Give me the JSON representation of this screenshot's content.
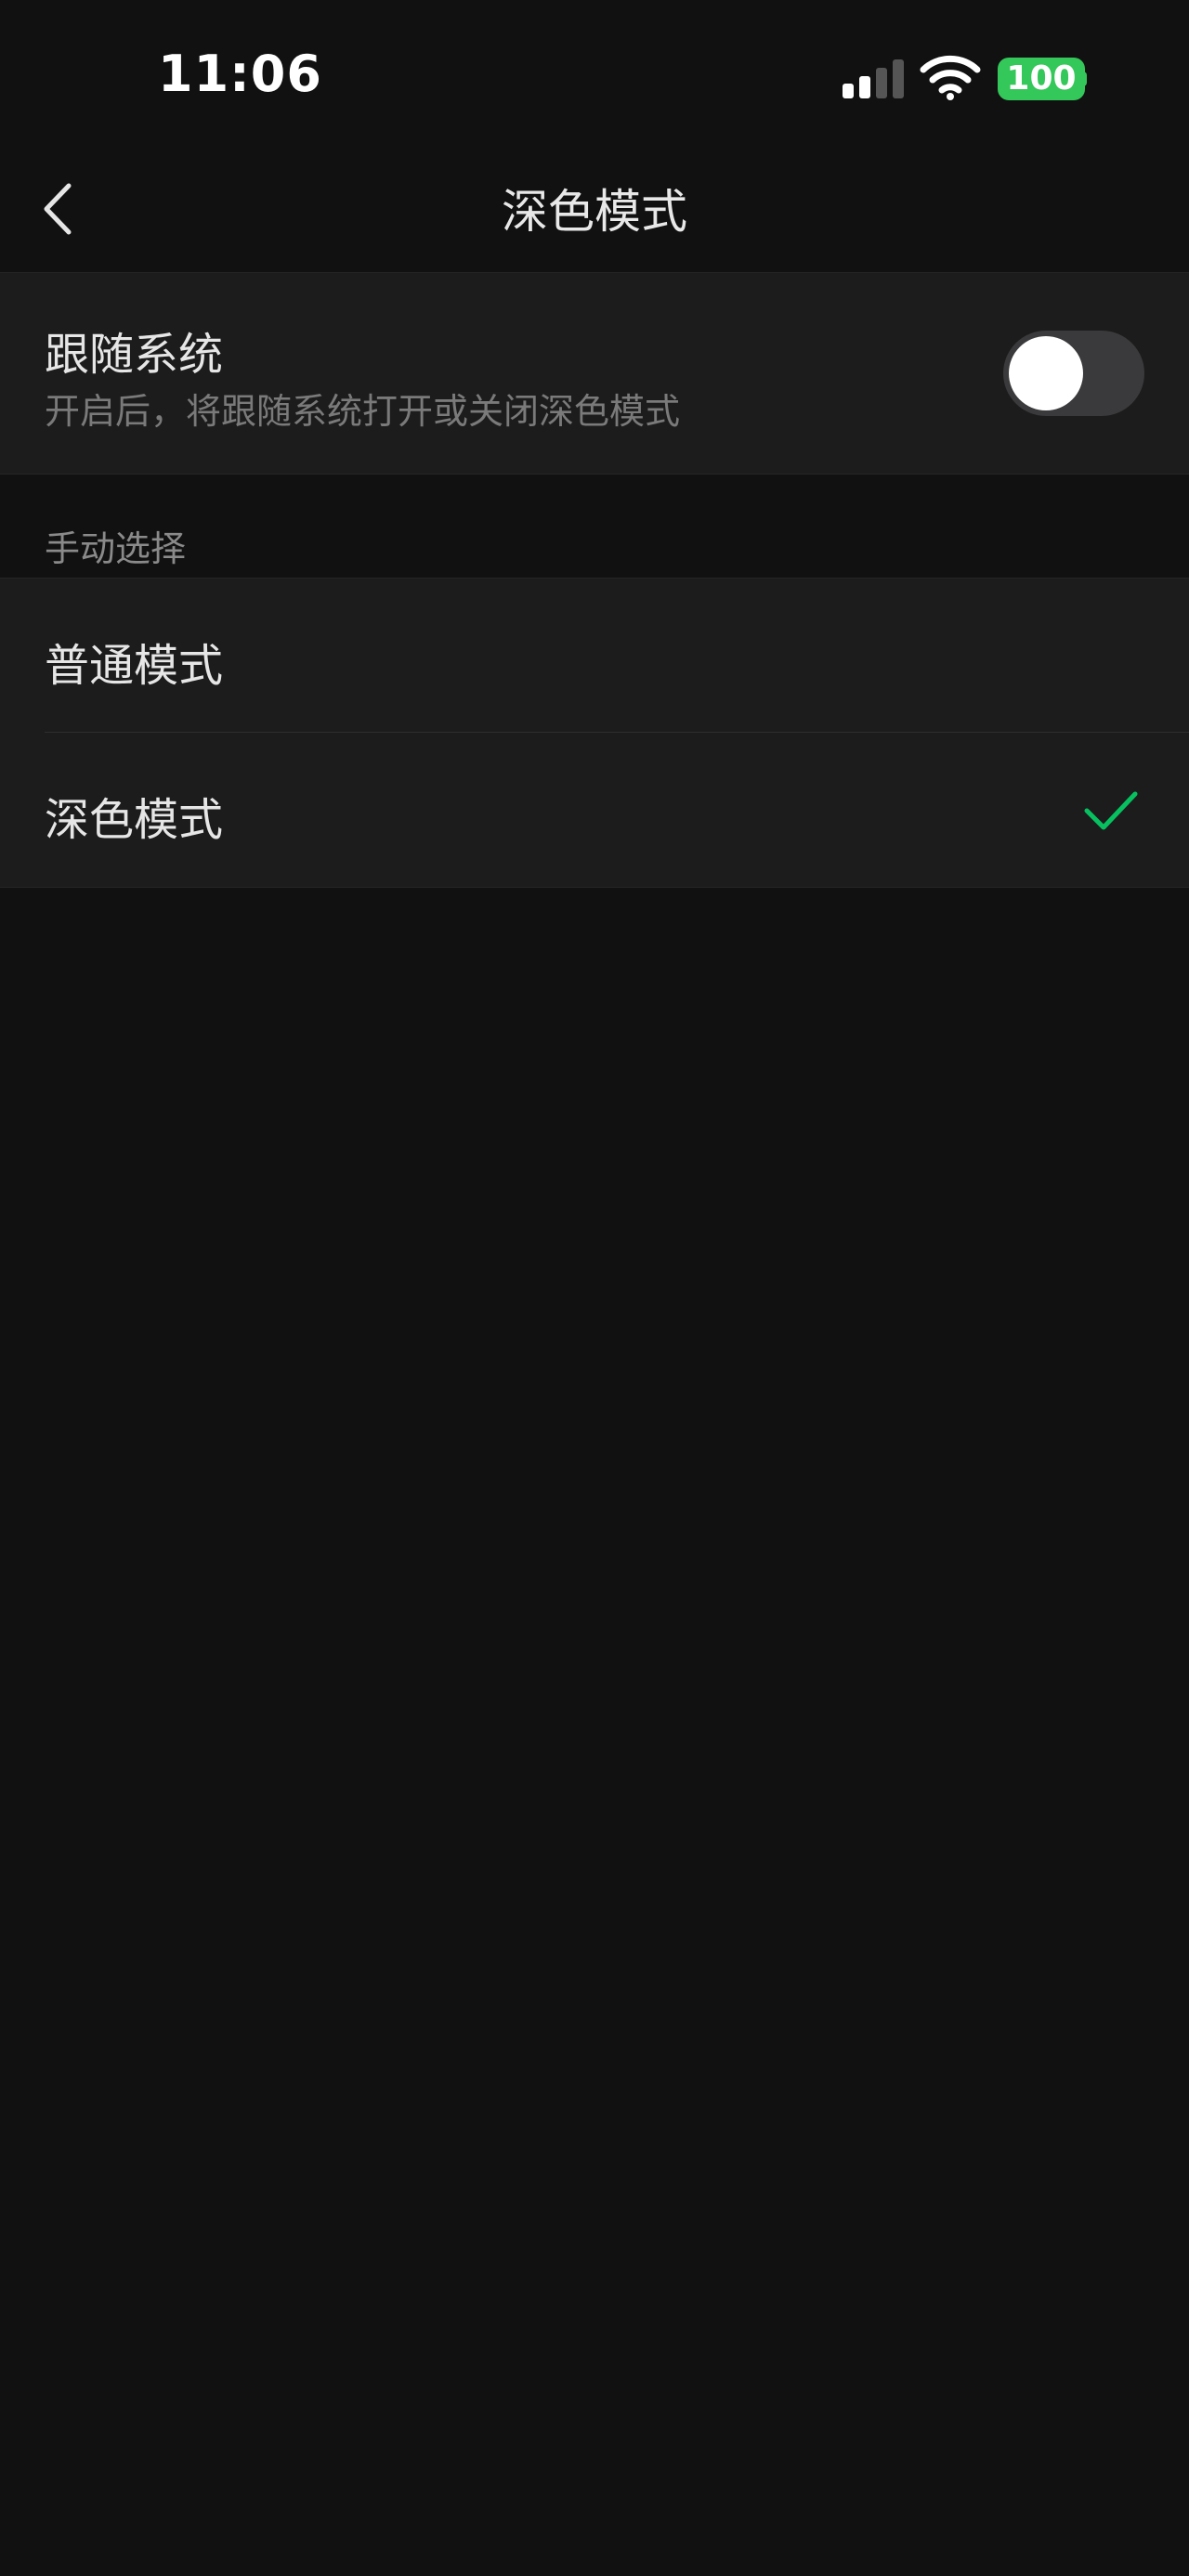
{
  "status_bar": {
    "time": "11:06",
    "battery": "100",
    "signal_icon": "cellular-signal-icon",
    "wifi_icon": "wifi-icon"
  },
  "nav": {
    "back_icon": "chevron-left-icon",
    "title": "深色模式"
  },
  "follow_system": {
    "title": "跟随系统",
    "description": "开启后，将跟随系统打开或关闭深色模式",
    "enabled": false
  },
  "manual": {
    "header": "手动选择",
    "options": [
      {
        "label": "普通模式",
        "selected": false
      },
      {
        "label": "深色模式",
        "selected": true
      }
    ]
  },
  "colors": {
    "background": "#111111",
    "card": "#1c1c1c",
    "accent": "#07c160",
    "battery": "#34c759"
  }
}
